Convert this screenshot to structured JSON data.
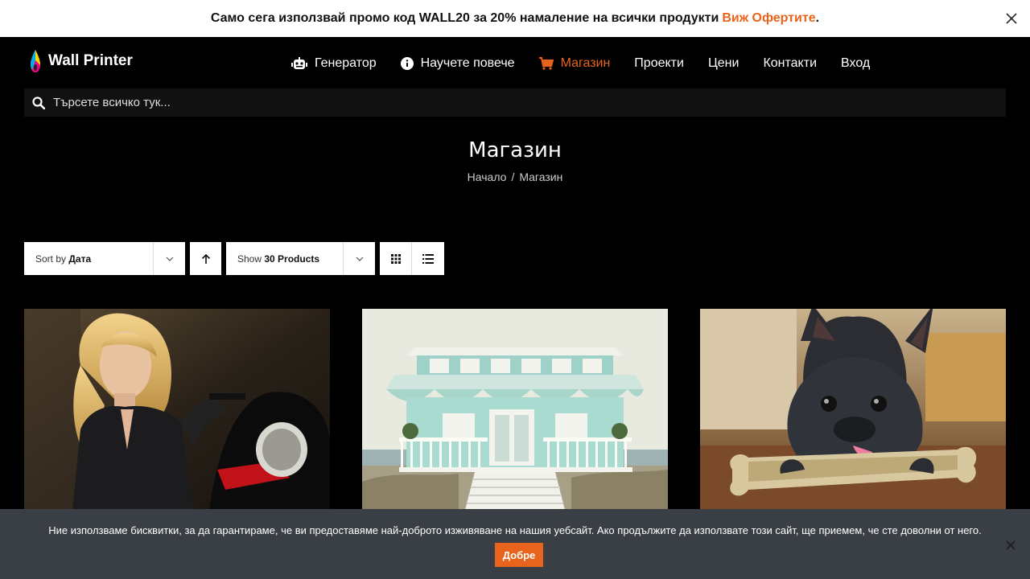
{
  "promo": {
    "text": "Само сега използвай промо код WALL20 за 20% намаление на всички продукти",
    "link": "Виж Офертите",
    "suffix": "."
  },
  "brand": {
    "name": "Wall Printer"
  },
  "nav": [
    {
      "label": "Генератор",
      "icon": "robot-icon"
    },
    {
      "label": "Научете повече",
      "icon": "info-icon"
    },
    {
      "label": "Магазин",
      "icon": "cart-icon",
      "active": true
    },
    {
      "label": "Проекти"
    },
    {
      "label": "Цени"
    },
    {
      "label": "Контакти"
    },
    {
      "label": "Вход"
    }
  ],
  "search": {
    "placeholder": "Търсете всичко тук..."
  },
  "page": {
    "title": "Магазин",
    "breadcrumb": {
      "home": "Начало",
      "separator": "/",
      "current": "Магазин"
    }
  },
  "toolbar": {
    "sort_prefix": "Sort by",
    "sort_value": "Дата",
    "show_prefix": "Show",
    "show_value": "30 Products"
  },
  "products": [
    {
      "image": "woman-motorcycle"
    },
    {
      "image": "beach-house"
    },
    {
      "image": "french-bulldog-bone"
    }
  ],
  "cookie": {
    "message": "Ние използваме бисквитки, за да гарантираме, че ви предоставяме най-доброто изживяване на нашия уебсайт. Ако продължите да използвате този сайт, ще приемем, че сте доволни от него.",
    "accept": "Добре"
  },
  "colors": {
    "accent": "#e8641c",
    "background": "#000000",
    "cookie_bg": "#3a3e45"
  }
}
